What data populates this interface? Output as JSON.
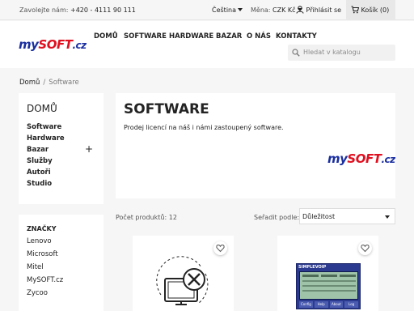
{
  "topbar": {
    "contact_label": "Zavolejte nám:",
    "contact_phone": "+420 - 4111 90 111",
    "language": "Čeština",
    "currency_label": "Měna:",
    "currency_value": "CZK Kč",
    "login": "Přihlásit se",
    "cart": "Košík (0)"
  },
  "header": {
    "logo": {
      "m": "my",
      "s": "SOFT",
      "c": ".cz"
    },
    "nav": [
      "DOMŮ",
      "SOFTWARE",
      "HARDWARE",
      "BAZAR",
      "O NÁS",
      "KONTAKTY"
    ],
    "search_placeholder": "Hledat v katalogu"
  },
  "breadcrumb": {
    "home": "Domů",
    "sep": "/",
    "current": "Software"
  },
  "sidebar": {
    "title": "DOMŮ",
    "items": [
      "Software",
      "Hardware",
      "Bazar",
      "Služby",
      "Autoři",
      "Studio"
    ],
    "expand": "+"
  },
  "brands": {
    "title": "ZNAČKY",
    "items": [
      "Lenovo",
      "Microsoft",
      "Mitel",
      "MySOFT.cz",
      "Zycoo"
    ]
  },
  "category": {
    "title": "SOFTWARE",
    "description": "Prodej licencí na náš i námi zastoupený software."
  },
  "listing": {
    "count": "Počet produktů: 12",
    "sort_label": "Seřadit podle:",
    "sort_value": "Důležitost"
  },
  "product2": {
    "window_title": "SIMPLEVOIP",
    "buttons": [
      "Config",
      "Help",
      "About",
      "Log"
    ]
  }
}
